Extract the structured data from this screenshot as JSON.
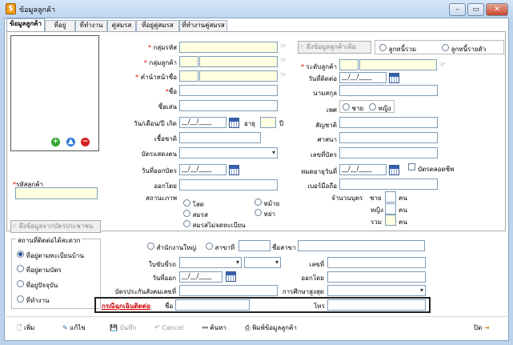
{
  "window": {
    "title": "ข้อมูลลูกค้า"
  },
  "tabs": [
    "ข้อมูลลูกค้า",
    "ที่อยู่",
    "ที่ทำงาน",
    "คู่สมรส",
    "ที่อยู่คู่สมรส",
    "ที่ทำงานคู่สมรส"
  ],
  "left": {
    "customer_code_label": "รหัสลูกค้า",
    "pull_from_id_card_button": "ดึงข้อมูลจากบัตรประชาชน"
  },
  "form": {
    "group_code_label": "กลุ่มรหัส",
    "customer_group_label": "กลุ่มลูกค้า",
    "title_prefix_label": "คำนำหน้าชื่อ",
    "first_name_label": "ชื่อ",
    "nickname_label": "ชื่อเล่น",
    "birthdate_label": "วัน/เดือน/ปี เกิด",
    "age_label": "อายุ",
    "year_unit": "ปี",
    "ethnicity_label": "เชื้อชาติ",
    "id_card_type_label": "บัตรแสดงตน",
    "issue_date_label": "วันที่ออกบัตร",
    "issued_by_label": "ออกโดย",
    "status_label": "สถานะภาพ",
    "pull_customer_button": "ดึงข้อมูลลูกค้าเดิม",
    "main_customer_radio": "ลูกหนี้รวม",
    "sub_customer_radio": "ลูกหนี้รายตัว",
    "customer_level_label": "ระดับลูกค้า",
    "contact_date_label": "วันที่ติดต่อ",
    "last_name_label": "นามสกุล",
    "gender_label": "เพศ",
    "male": "ชาย",
    "female": "หญิง",
    "nationality_label": "สัญชาติ",
    "religion_label": "ศาสนา",
    "id_number_label": "เลขที่บัตร",
    "expiry_label": "หมดอายุวันที่",
    "lifetime_card_label": "บัตรตลอดชีพ",
    "mobile_label": "เบอร์มือถือ",
    "date_placeholder": "__/__/____",
    "status_options": [
      "โสด",
      "หม้าย",
      "สมรส",
      "หย่า",
      "สมรสไม่จดทะเบียน"
    ],
    "children_label": "จำนวนบุตร",
    "children_male": "ชาย",
    "children_female": "หญิง",
    "children_total": "รวม",
    "children_unit": "คน"
  },
  "bottom": {
    "contact_place_title": "สถานที่ติดต่อได้สะดวก",
    "contact_options": [
      "ที่อยู่ตามทะเบียนบ้าน",
      "ที่อยู่ตามบัตร",
      "ที่อยู่ปัจจุบัน",
      "ที่ทำงาน"
    ],
    "head_office": "สำนักงานใหญ่",
    "branch": "สาขาที่",
    "branch_name_label": "ชื่อสาขา",
    "license_label": "ใบขับขี่รถ",
    "number_label": "เลขที่",
    "issue_date_label": "วันที่ออก",
    "issued_by_label": "ออกโดย",
    "social_security_label": "บัตรประกันสังคมเลขที่",
    "education_label": "การศึกษาสูงสุด",
    "emergency_label": "กรณีฉุกเฉินติดต่อ",
    "name_label": "ชื่อ",
    "phone_label": "โทร"
  },
  "toolbar": {
    "add": "เพิ่ม",
    "edit": "แก้ไข",
    "save": "บันทึก",
    "cancel": "Cancel",
    "search": "ค้นหา",
    "print": "พิมพ์ข้อมูลลูกค้า",
    "close": "ปิด"
  }
}
